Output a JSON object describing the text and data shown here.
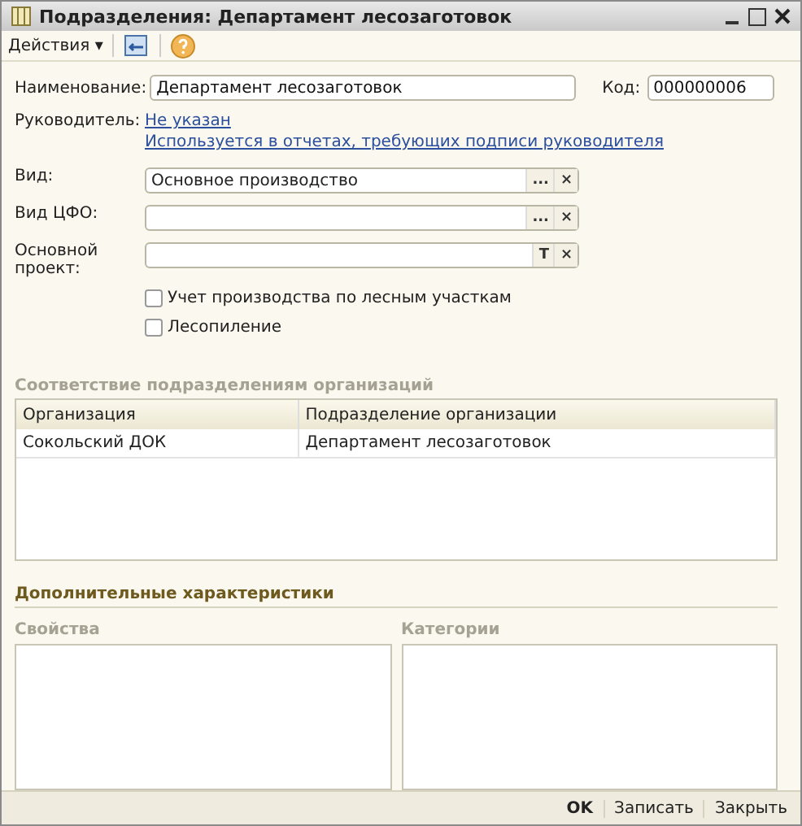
{
  "window": {
    "title": "Подразделения: Департамент лесозаготовок"
  },
  "toolbar": {
    "menu": "Действия ▾"
  },
  "name_field": {
    "label": "Наименование:",
    "value": "Департамент лесозаготовок"
  },
  "code_field": {
    "label": "Код:",
    "value": "000000006"
  },
  "manager": {
    "label": "Руководитель:",
    "link": "Не указан",
    "hint": "Используется в отчетах, требующих подписи руководителя"
  },
  "fields": [
    {
      "label": "Вид:",
      "value": "Основное производство",
      "buttons": [
        "...",
        "×"
      ]
    },
    {
      "label": "Вид ЦФО:",
      "buttons": [
        "...",
        "×"
      ]
    },
    {
      "label": "Основной проект:",
      "buttons": [
        "T",
        "×"
      ]
    }
  ],
  "checkboxes": [
    {
      "label": "Учет производства по лесным участкам",
      "checked": false
    },
    {
      "label": "Лесопиление",
      "checked": false
    }
  ],
  "mapping": {
    "title": "Соответствие подразделениям организаций",
    "columns": [
      "Организация",
      "Подразделение организации"
    ],
    "rows": [
      [
        "Сокольский ДОК",
        "Департамент лесозаготовок"
      ]
    ]
  },
  "extra": {
    "title": "Дополнительные характеристики",
    "panels": [
      "Свойства",
      "Категории"
    ]
  },
  "footer": [
    {
      "label": "OK",
      "kind": "default"
    },
    {
      "label": "Записать",
      "kind": "plain"
    },
    {
      "label": "Закрыть",
      "kind": "plain"
    }
  ]
}
